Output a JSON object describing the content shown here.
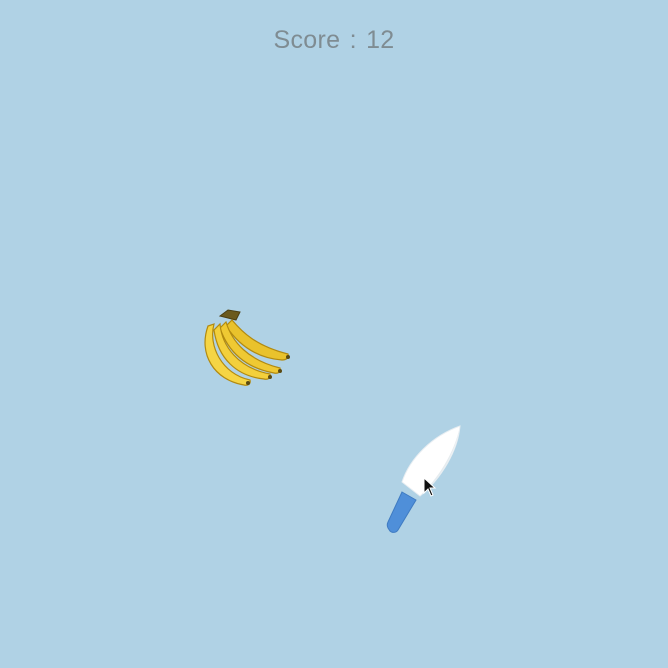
{
  "hud": {
    "score_label": "Score",
    "score_separator": ":",
    "score_value": "12"
  },
  "objects": [
    {
      "kind": "fruit",
      "icon": "banana-bunch-icon"
    },
    {
      "kind": "blade",
      "icon": "knife-icon"
    },
    {
      "kind": "pointer",
      "icon": "mouse-cursor-icon"
    }
  ],
  "colors": {
    "background": "#b0d2e5",
    "score_text": "#7f8c92",
    "knife_blade": "#ffffff",
    "knife_handle": "#4f8fd9",
    "banana": "#f2d13a"
  }
}
